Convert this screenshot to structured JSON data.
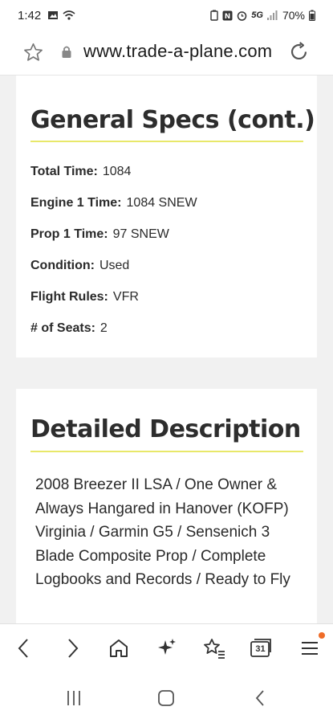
{
  "status_bar": {
    "time": "1:42",
    "network": "5G",
    "battery": "70%"
  },
  "browser": {
    "url": "www.trade-a-plane.com"
  },
  "general_specs": {
    "title": "General Specs (cont.)",
    "rows": [
      {
        "label": "Total Time:",
        "value": "1084"
      },
      {
        "label": "Engine 1 Time:",
        "value": "1084 SNEW"
      },
      {
        "label": "Prop 1 Time:",
        "value": "97 SNEW"
      },
      {
        "label": "Condition:",
        "value": "Used"
      },
      {
        "label": "Flight Rules:",
        "value": "VFR"
      },
      {
        "label": "# of Seats:",
        "value": "2"
      }
    ]
  },
  "detailed_description": {
    "title": "Detailed Description",
    "text": "2008 Breezer II LSA / One Owner & Always Hangared in Hanover (KOFP) Virginia / Garmin G5 / Sensenich 3 Blade Composite Prop / Complete Logbooks and Records / Ready to Fly"
  },
  "bottom_nav": {
    "calendar_day": "31",
    "icons": [
      "back-icon",
      "forward-icon",
      "home-icon",
      "sparkle-icon",
      "bookmarks-icon",
      "tabs-icon",
      "menu-icon"
    ],
    "notification_color": "#ef6c28"
  },
  "colors": {
    "accent_rule": "#e8e86a",
    "page_bg": "#f1f1f1"
  }
}
